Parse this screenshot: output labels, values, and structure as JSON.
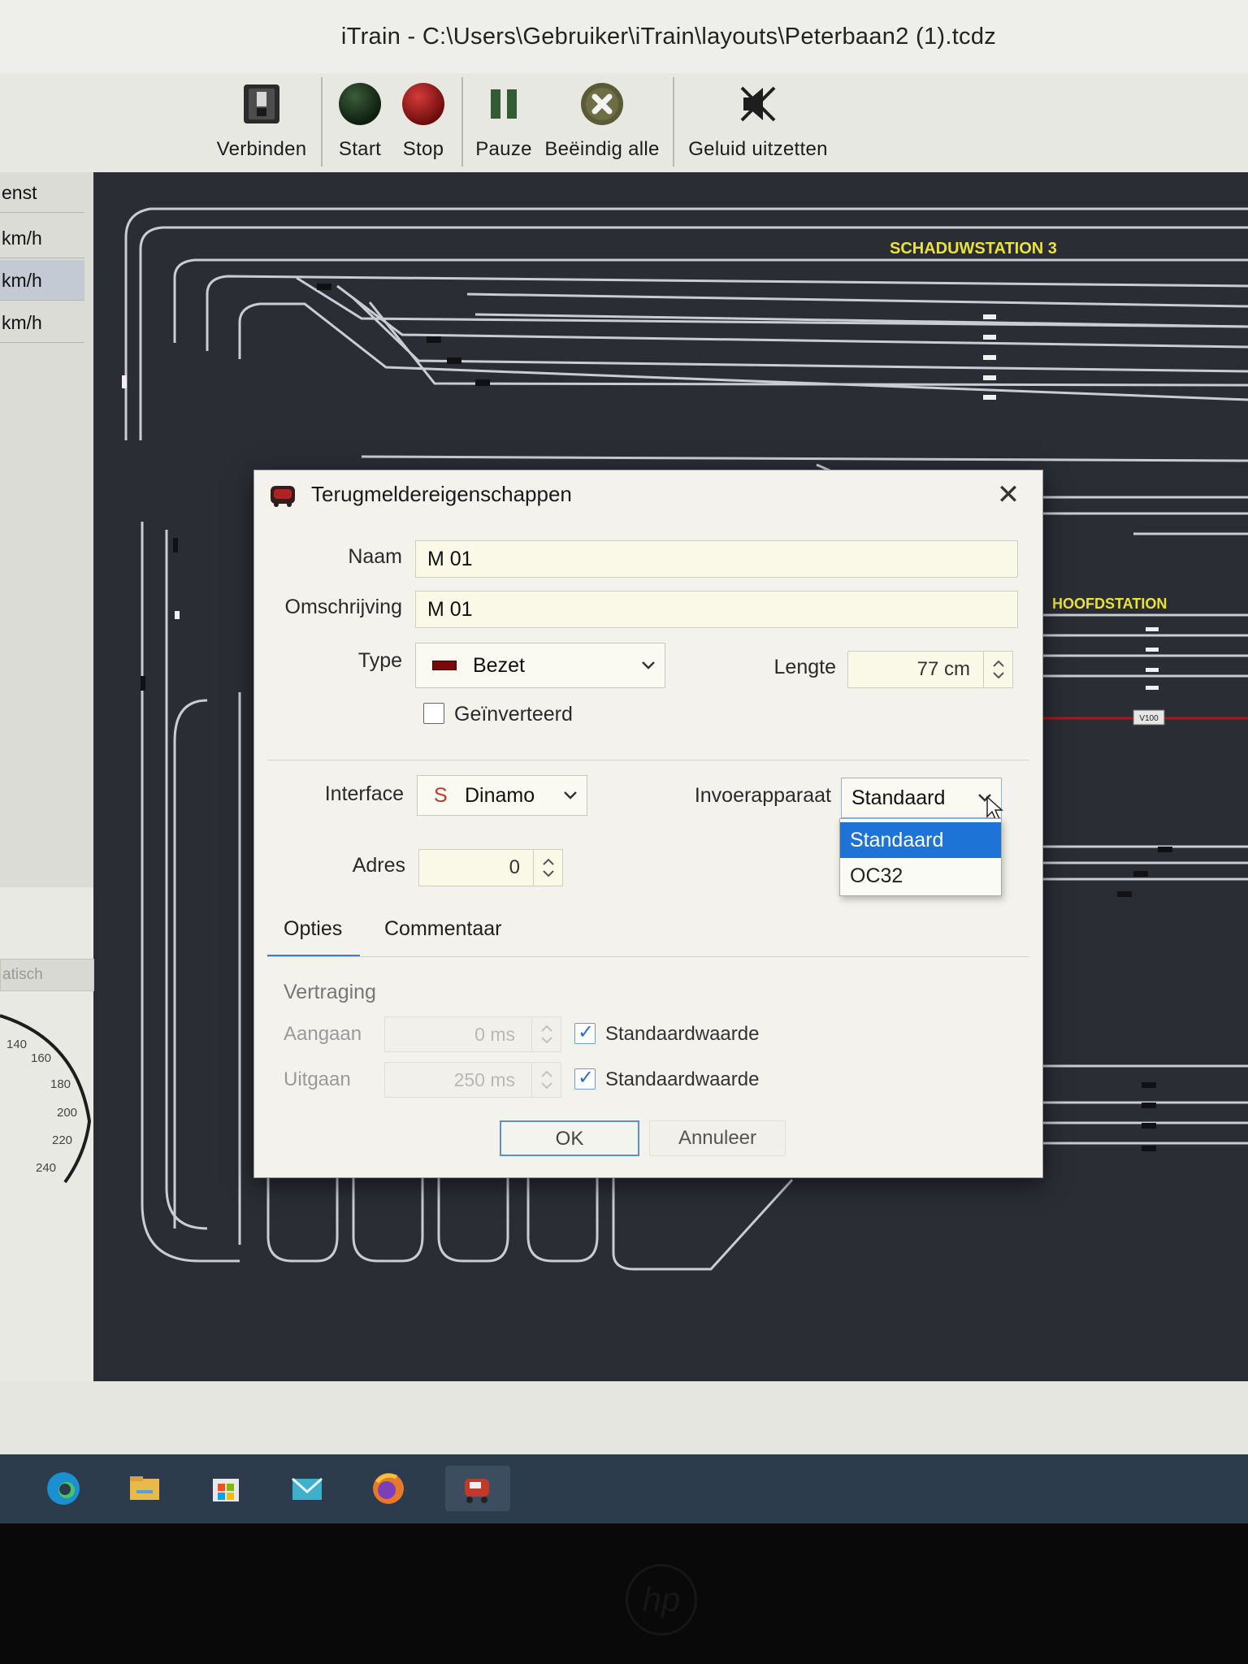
{
  "window": {
    "title": "iTrain - C:\\Users\\Gebruiker\\iTrain\\layouts\\Peterbaan2 (1).tcdz"
  },
  "toolbar": {
    "connect": "Verbinden",
    "start": "Start",
    "stop": "Stop",
    "pause": "Pauze",
    "end_all": "Beëindig alle",
    "mute": "Geluid uitzetten"
  },
  "left_panel": {
    "header": "enst",
    "rows": [
      "km/h",
      "km/h",
      "km/h"
    ],
    "mode_partial": "atisch",
    "speedometer_ticks": [
      "140",
      "160",
      "180",
      "200",
      "220",
      "240"
    ]
  },
  "track": {
    "station_labels": [
      "SCHADUWSTATION 3",
      "HOOFDSTATION"
    ],
    "signal_label": "V100"
  },
  "dialog": {
    "title": "Terugmeldereigenschappen",
    "name_label": "Naam",
    "name_value": "M 01",
    "description_label": "Omschrijving",
    "description_value": "M 01",
    "type_label": "Type",
    "type_value": "Bezet",
    "length_label": "Lengte",
    "length_value": "77 cm",
    "inverted_label": "Geïnverteerd",
    "inverted_checked": false,
    "interface_label": "Interface",
    "interface_badge": "S",
    "interface_value": "Dinamo",
    "input_device_label": "Invoerapparaat",
    "input_device_value": "Standaard",
    "input_device_options": [
      "Standaard",
      "OC32"
    ],
    "input_device_highlighted": "Standaard",
    "address_label": "Adres",
    "address_value": "0",
    "tabs": [
      "Opties",
      "Commentaar"
    ],
    "active_tab": "Opties",
    "delay_heading": "Vertraging",
    "on_label": "Aangaan",
    "on_value": "0 ms",
    "on_default_label": "Standaardwaarde",
    "on_default_checked": true,
    "off_label": "Uitgaan",
    "off_value": "250 ms",
    "off_default_label": "Standaardwaarde",
    "off_default_checked": true,
    "ok_label": "OK",
    "cancel_label": "Annuleer"
  },
  "colors": {
    "selection_blue": "#1d73d6",
    "track_background": "#2b2d35",
    "station_label_yellow": "#e8e23a",
    "occupied_red": "#7a0a0a"
  },
  "taskbar": {
    "apps": [
      "edge-icon",
      "file-explorer-icon",
      "store-icon",
      "mail-icon",
      "firefox-icon",
      "itrain-icon"
    ]
  }
}
